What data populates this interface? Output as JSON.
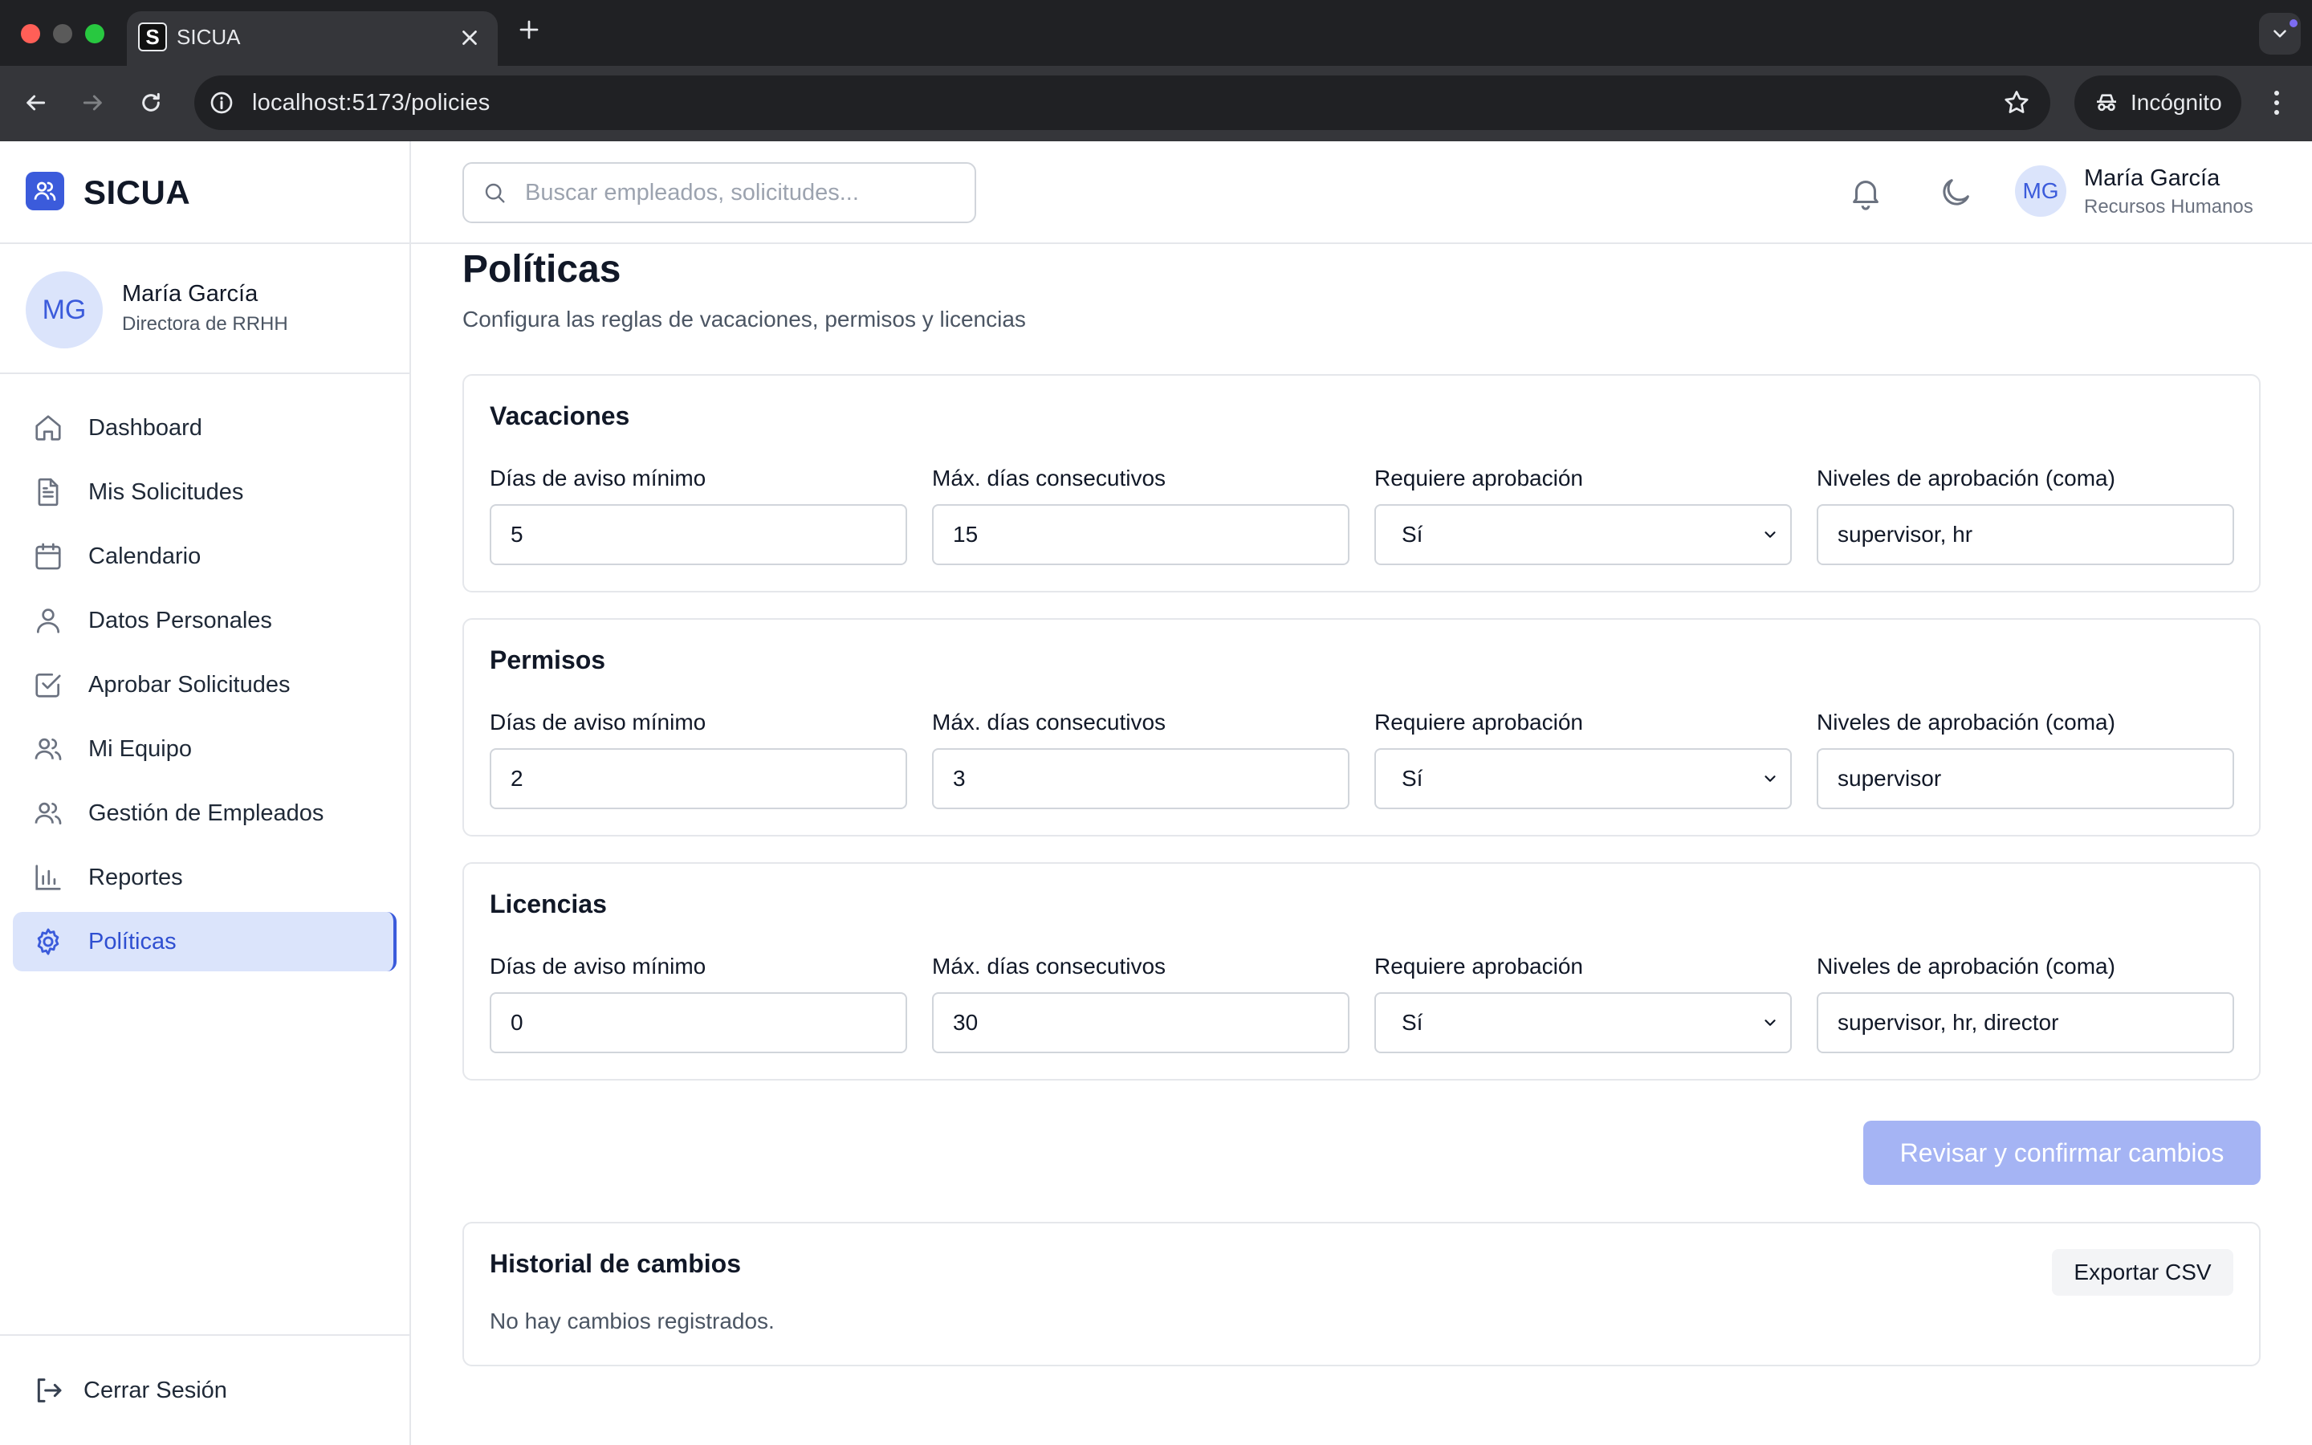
{
  "browser": {
    "tab_title": "SICUA",
    "favicon_letter": "S",
    "url": "localhost:5173/policies",
    "incognito_label": "Incógnito"
  },
  "sidebar": {
    "brand": "SICUA",
    "user": {
      "initials": "MG",
      "name": "María García",
      "role": "Directora de RRHH"
    },
    "items": [
      {
        "label": "Dashboard",
        "icon": "home-icon"
      },
      {
        "label": "Mis Solicitudes",
        "icon": "document-icon"
      },
      {
        "label": "Calendario",
        "icon": "calendar-icon"
      },
      {
        "label": "Datos Personales",
        "icon": "user-icon"
      },
      {
        "label": "Aprobar Solicitudes",
        "icon": "check-square-icon"
      },
      {
        "label": "Mi Equipo",
        "icon": "users-icon"
      },
      {
        "label": "Gestión de Empleados",
        "icon": "users-icon"
      },
      {
        "label": "Reportes",
        "icon": "bar-chart-icon"
      },
      {
        "label": "Políticas",
        "icon": "gear-icon",
        "active": true
      }
    ],
    "logout_label": "Cerrar Sesión"
  },
  "header": {
    "search_placeholder": "Buscar empleados, solicitudes...",
    "user": {
      "initials": "MG",
      "name": "María García",
      "role": "Recursos Humanos"
    }
  },
  "page": {
    "title": "Políticas",
    "subtitle": "Configura las reglas de vacaciones, permisos y licencias"
  },
  "field_labels": {
    "notice": "Días de aviso mínimo",
    "max_days": "Máx. días consecutivos",
    "requires_approval": "Requiere aprobación",
    "approval_levels": "Niveles de aprobación (coma)"
  },
  "policies": [
    {
      "title": "Vacaciones",
      "notice": "5",
      "max_days": "15",
      "requires_approval": "Sí",
      "approval_levels": "supervisor, hr"
    },
    {
      "title": "Permisos",
      "notice": "2",
      "max_days": "3",
      "requires_approval": "Sí",
      "approval_levels": "supervisor"
    },
    {
      "title": "Licencias",
      "notice": "0",
      "max_days": "30",
      "requires_approval": "Sí",
      "approval_levels": "supervisor, hr, director"
    }
  ],
  "confirm_button": "Revisar y confirmar cambios",
  "history": {
    "title": "Historial de cambios",
    "export_label": "Exportar CSV",
    "empty_text": "No hay cambios registrados."
  },
  "colors": {
    "accent": "#3b5bdb",
    "active_bg": "#dbe4fb",
    "disabled_button": "#a5b4f4"
  }
}
